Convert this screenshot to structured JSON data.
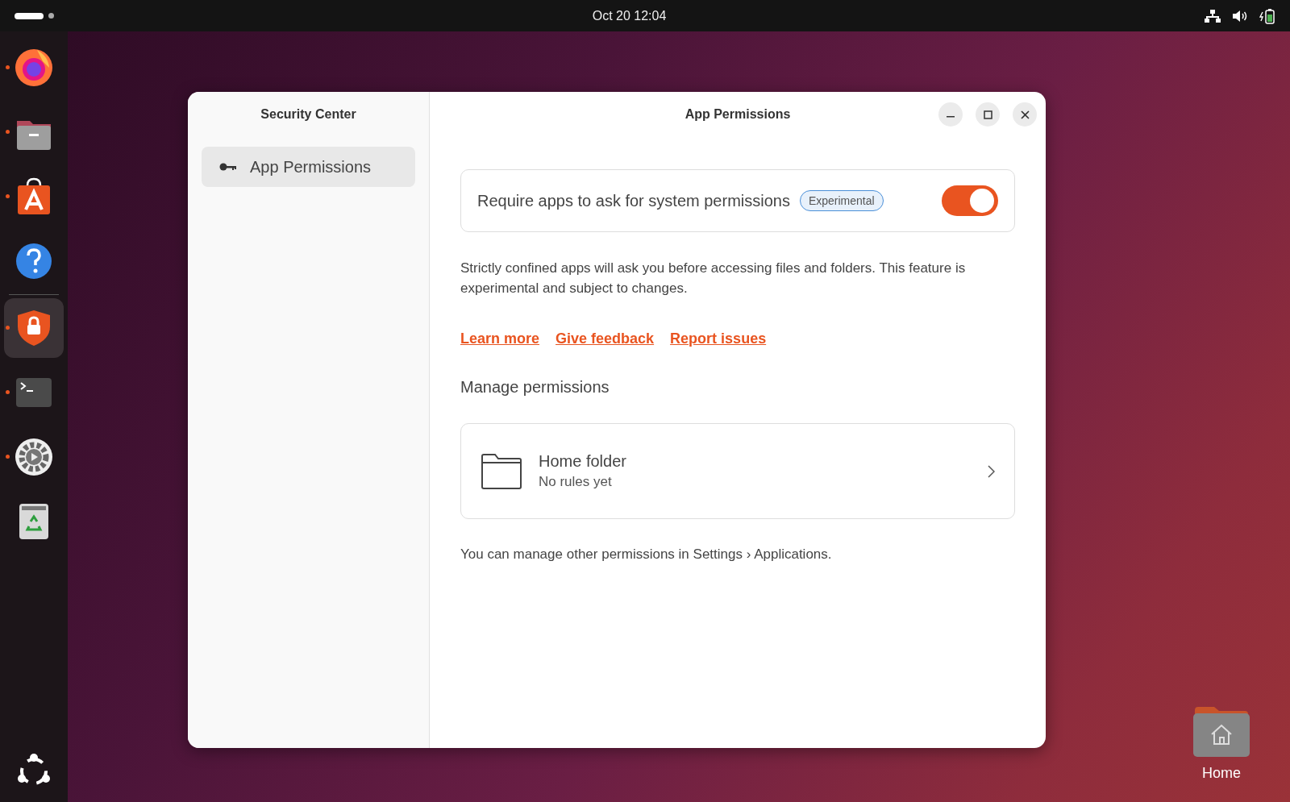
{
  "top_bar": {
    "clock": "Oct 20  12:04"
  },
  "dock": {
    "items": [
      {
        "kind": "browser",
        "running": true,
        "selected": false
      },
      {
        "kind": "files",
        "running": true,
        "selected": false
      },
      {
        "kind": "store",
        "running": true,
        "selected": false
      },
      {
        "kind": "help",
        "running": false,
        "selected": false
      },
      {
        "kind": "security",
        "running": true,
        "selected": true
      },
      {
        "kind": "terminal",
        "running": true,
        "selected": false
      },
      {
        "kind": "settings",
        "running": true,
        "selected": false
      },
      {
        "kind": "trash",
        "running": false,
        "selected": false
      }
    ]
  },
  "window": {
    "sidebar": {
      "title": "Security Center",
      "items": [
        {
          "label": "App Permissions",
          "selected": true
        }
      ]
    },
    "title": "App Permissions",
    "toggle_row": {
      "label": "Require apps to ask for system permissions",
      "badge": "Experimental",
      "on": true
    },
    "description": "Strictly confined apps will ask you before accessing files and folders. This feature is experimental and subject to changes.",
    "links": [
      "Learn more",
      "Give feedback",
      "Report issues"
    ],
    "section_title": "Manage permissions",
    "permissions": [
      {
        "title": "Home folder",
        "subtitle": "No rules yet"
      }
    ],
    "note": "You can manage other permissions in Settings › Applications."
  },
  "desktop_icons": [
    {
      "label": "Home"
    }
  ]
}
